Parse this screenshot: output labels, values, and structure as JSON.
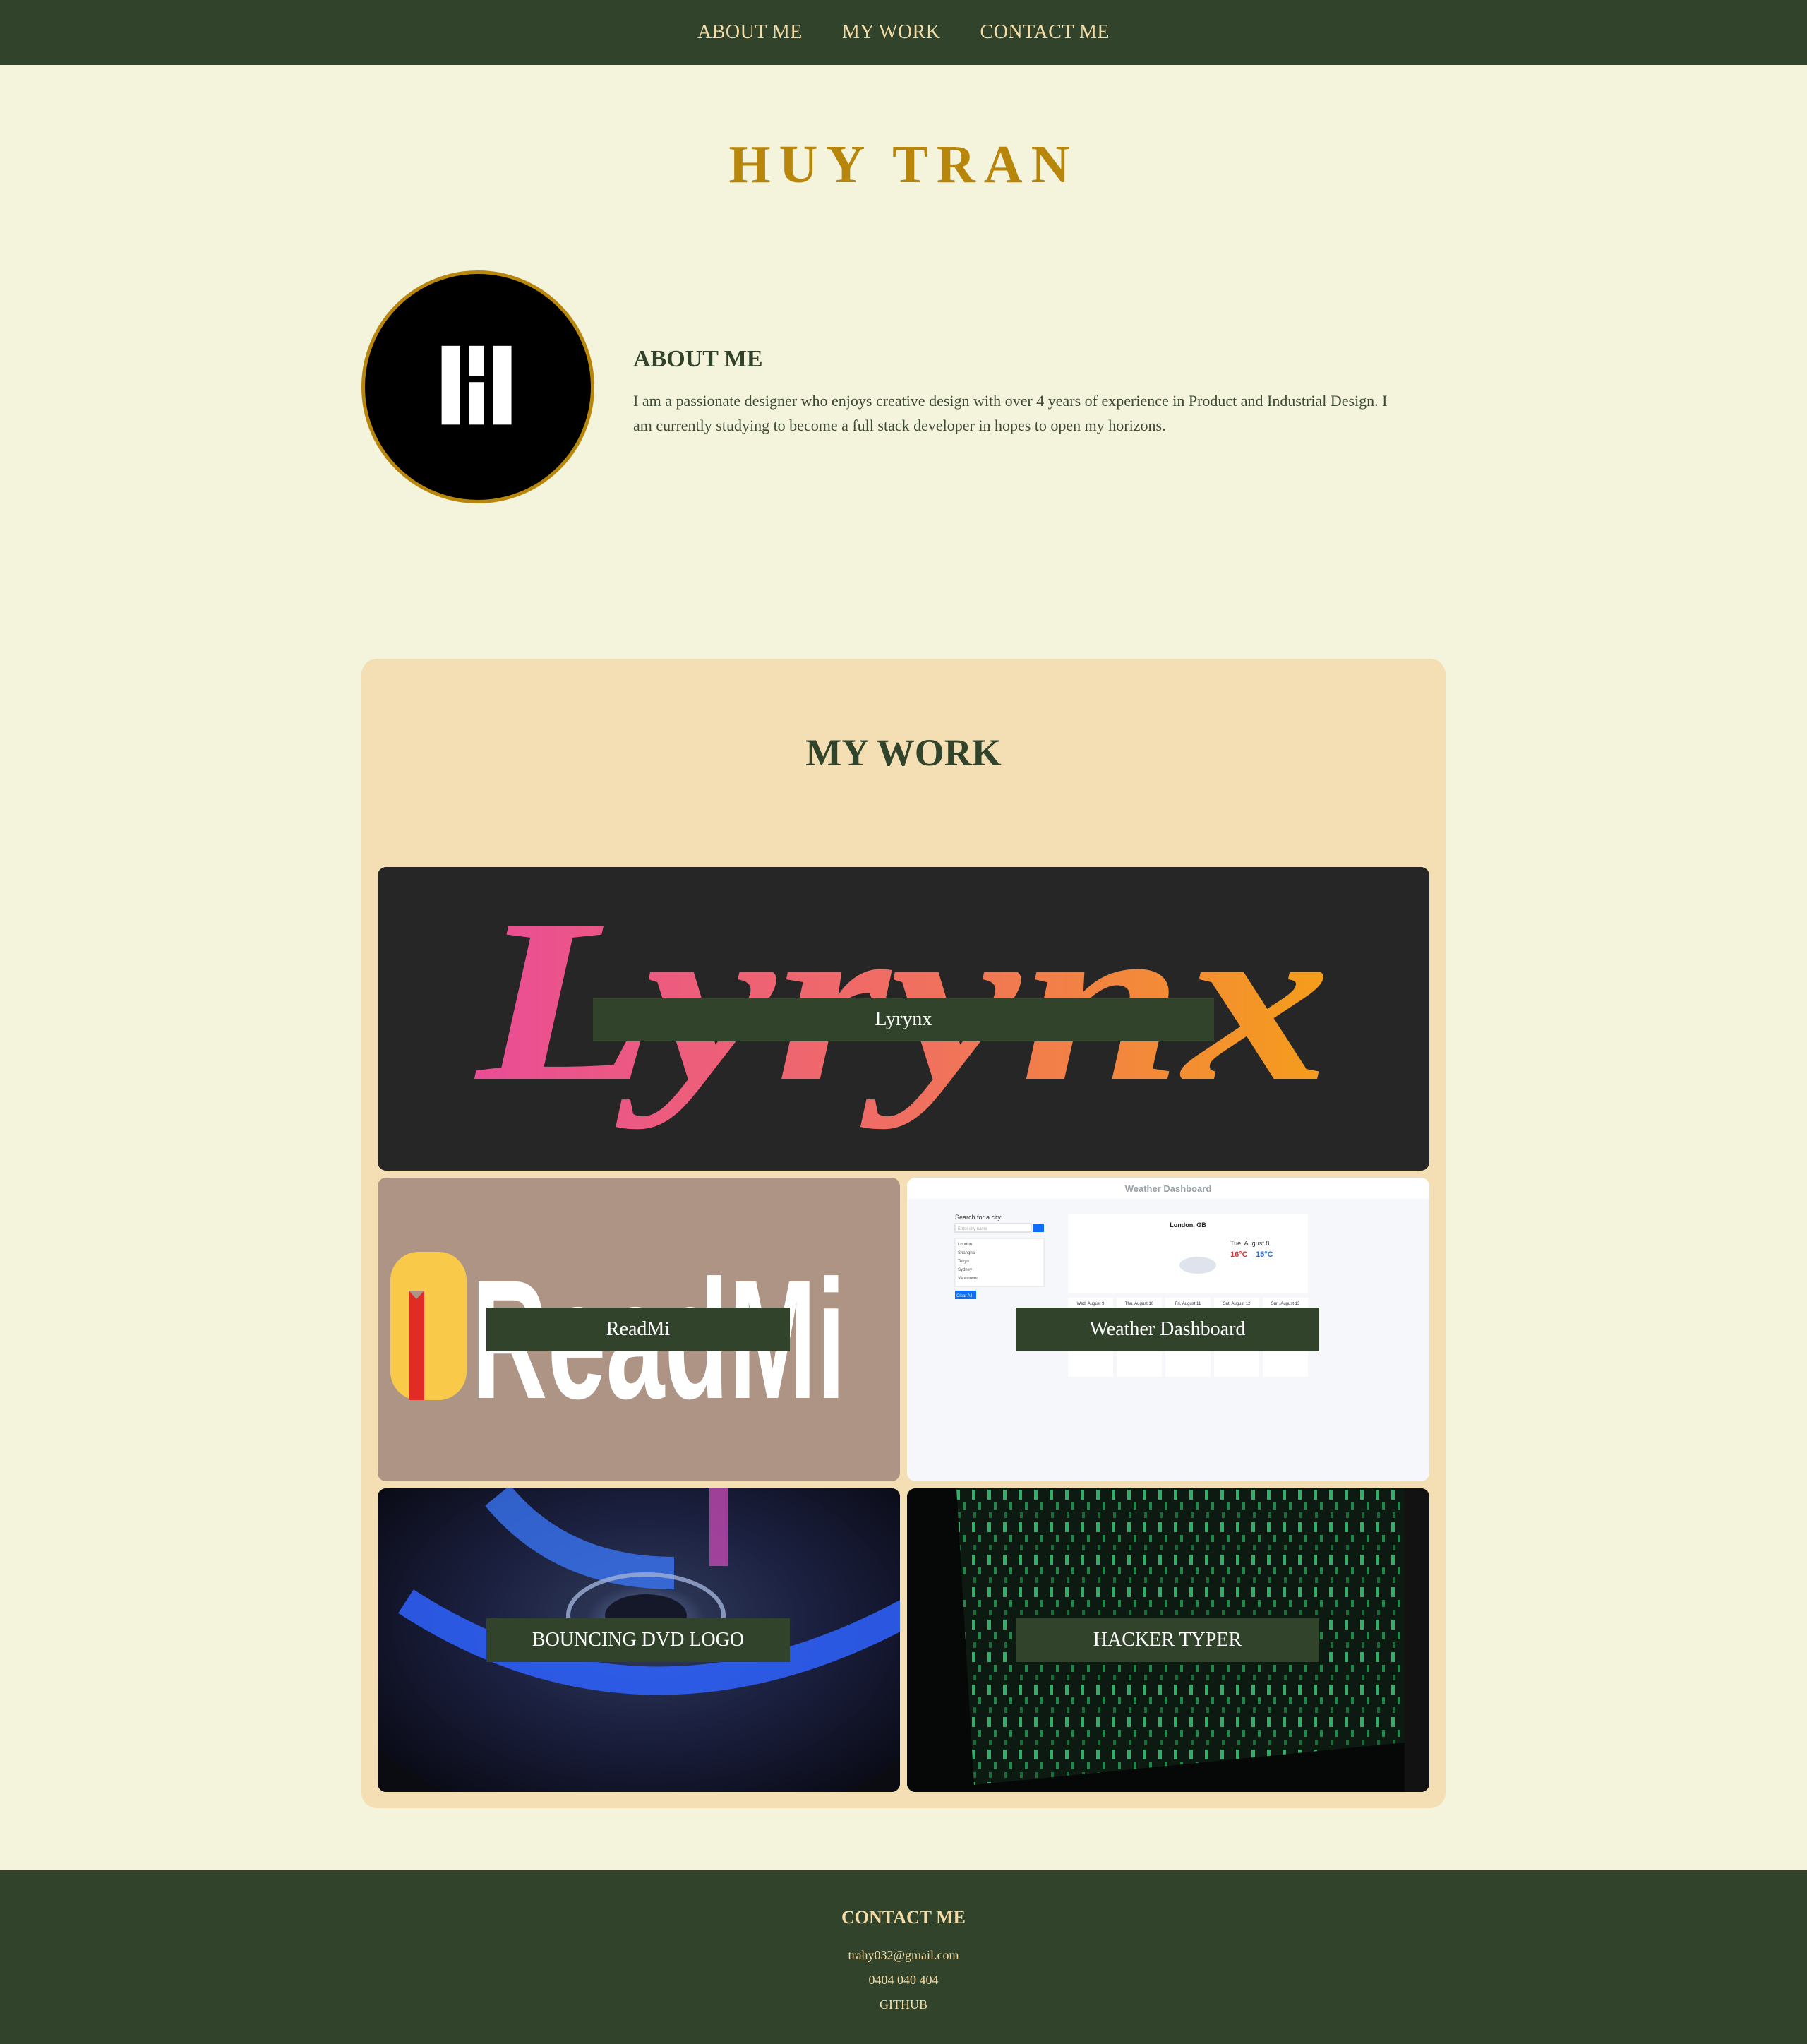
{
  "nav": {
    "items": [
      {
        "label": "ABOUT ME"
      },
      {
        "label": "MY WORK"
      },
      {
        "label": "CONTACT ME"
      }
    ]
  },
  "header": {
    "title": "HUY TRAN"
  },
  "about": {
    "avatar_icon": "monogram-logo-icon",
    "heading": "ABOUT ME",
    "text": "I am a passionate designer who enjoys creative design with over 4 years of experience in Product and Industrial Design. I am currently studying to become a full stack developer in hopes to open my horizons."
  },
  "work": {
    "heading": "MY WORK",
    "projects": [
      {
        "label": "Lyrynx",
        "art_text": "Lyrynx"
      },
      {
        "label": "ReadMi",
        "art_text": "ReadMi"
      },
      {
        "label": "Weather Dashboard",
        "screenshot": {
          "title": "Weather Dashboard",
          "search_label": "Search for a city:",
          "search_placeholder": "Enter city name",
          "cities": [
            "London",
            "Shanghai",
            "Tokyo",
            "Sydney",
            "Vancouver"
          ],
          "clear_button": "Clear All",
          "current_city": "London, GB",
          "current_date": "Tue, August 8",
          "temp_high": "16°C",
          "temp_low": "15°C",
          "forecast_days": [
            "Wed, August 9",
            "Thu, August 10",
            "Fri, August 11",
            "Sat, August 12",
            "Sun, August 13"
          ],
          "forecast_temp": "15°C"
        }
      },
      {
        "label": "BOUNCING DVD LOGO"
      },
      {
        "label": "HACKER TYPER"
      }
    ]
  },
  "footer": {
    "heading": "CONTACT ME",
    "email": "trahy032@gmail.com",
    "phone": "0404 040 404",
    "github": "GITHUB"
  },
  "colors": {
    "nav_bg": "#31432a",
    "page_bg": "#f4f4dc",
    "accent_gold": "#b8860b",
    "work_panel_bg": "#f4deb3",
    "nav_text": "#f3dca8"
  }
}
